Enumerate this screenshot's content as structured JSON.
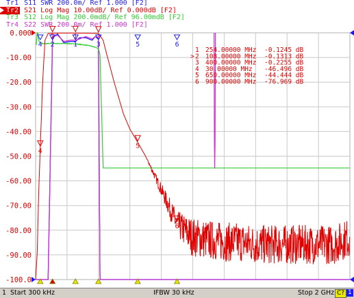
{
  "traces": [
    {
      "tag": "Tr1",
      "param": "S11",
      "format": "SWR",
      "scale": "200.0m/",
      "ref": "Ref 1.000",
      "channel": "[F2]",
      "color": "#1a1aff",
      "active": false
    },
    {
      "tag": "Tr2",
      "param": "S21",
      "format": "Log Mag",
      "scale": "10.00dB/",
      "ref": "Ref 0.000dB",
      "channel": "[F2]",
      "color": "#e00000",
      "active": true
    },
    {
      "tag": "Tr3",
      "param": "S12",
      "format": "Log Mag",
      "scale": "200.0mdB/",
      "ref": "Ref 96.00mdB",
      "channel": "[F2]",
      "color": "#33cc33",
      "active": false
    },
    {
      "tag": "Tr4",
      "param": "S22",
      "format": "SWR",
      "scale": "200.0m/",
      "ref": "Ref 1.000",
      "channel": "[F2]",
      "color": "#cc33cc",
      "active": false
    }
  ],
  "y_axis": {
    "labels": [
      "0.000",
      "-10.00",
      "-20.00",
      "-30.00",
      "-40.00",
      "-50.00",
      "-60.00",
      "-70.00",
      "-80.00",
      "-90.00",
      "-100.0"
    ],
    "ylim": [
      -100,
      0
    ],
    "color": "#e00000"
  },
  "x_axis": {
    "start_mhz": 0.3,
    "stop_mhz": 2000,
    "divisions": 10
  },
  "marker_table": {
    "active_prefix": ">",
    "rows": [
      {
        "num": "1",
        "freq": "254.00000 MHz",
        "value": "-0.1245 dB",
        "active": false
      },
      {
        "num": "2",
        "freq": "108.00000 MHz",
        "value": "-0.1313 dB",
        "active": true
      },
      {
        "num": "3",
        "freq": "400.00000 MHz",
        "value": "-0.2255 dB",
        "active": false
      },
      {
        "num": "4",
        "freq": "30.00000 MHz",
        "value": "-46.496 dB",
        "active": false
      },
      {
        "num": "5",
        "freq": "650.00000 MHz",
        "value": "-44.444 dB",
        "active": false
      },
      {
        "num": "6",
        "freq": "900.00000 MHz",
        "value": "-76.969 dB",
        "active": false
      }
    ]
  },
  "chart_data": {
    "type": "line",
    "title": "",
    "xlabel": "",
    "ylabel": "",
    "xlim_mhz": [
      0.3,
      2000
    ],
    "ylim": [
      -100,
      0
    ],
    "grid": true,
    "series": [
      {
        "name": "S21",
        "color": "#e00000",
        "x_mhz": [
          0.3,
          10,
          20,
          30,
          45,
          60,
          80,
          108,
          160,
          254,
          320,
          400,
          430,
          450,
          500,
          560,
          600,
          650,
          700,
          760,
          820,
          900,
          1000,
          1100,
          1200,
          1300,
          1400,
          1500,
          1600,
          1700,
          1800,
          1900,
          2000
        ],
        "y_db": [
          -100,
          -90,
          -65,
          -46.5,
          -20,
          -3,
          -0.3,
          -0.13,
          -0.12,
          -0.12,
          -0.15,
          -0.23,
          -3,
          -8,
          -20,
          -33,
          -39,
          -44.4,
          -50,
          -58,
          -66,
          -77,
          -82,
          -83,
          -84,
          -84,
          -85,
          -85,
          -85,
          -85,
          -85,
          -85,
          -82
        ]
      },
      {
        "name": "S12",
        "color": "#33cc33",
        "x_mhz": [
          0.3,
          5,
          10,
          15,
          18,
          22,
          30,
          40,
          60,
          80,
          108,
          140,
          180,
          220,
          254,
          290,
          320,
          350,
          370,
          390,
          400,
          410,
          430,
          2000
        ],
        "y_mdb": [
          0,
          0,
          96,
          96,
          44,
          28,
          12,
          10,
          8,
          9,
          10,
          9,
          9,
          8,
          6,
          1,
          -4,
          -10,
          -18,
          -26,
          -34,
          -80,
          -1000,
          -1000
        ]
      },
      {
        "name": "S11",
        "color": "#1a1aff",
        "x_mhz": [
          0.3,
          20,
          40,
          60,
          80,
          108,
          140,
          180,
          220,
          254,
          280,
          320,
          360,
          380,
          400,
          410,
          420,
          430,
          2000
        ],
        "swr": [
          3.0,
          3.0,
          3.0,
          3.0,
          3.0,
          1.04,
          1.01,
          1.08,
          1.07,
          1.07,
          1.04,
          1.04,
          1.06,
          1.03,
          1.05,
          3.0,
          3.0,
          3.0,
          3.0
        ]
      },
      {
        "name": "S22",
        "color": "#cc33cc",
        "x_mhz": [
          0.3,
          20,
          40,
          60,
          80,
          108,
          140,
          180,
          220,
          254,
          280,
          320,
          360,
          380,
          400,
          410,
          420,
          430,
          2000
        ],
        "swr": [
          3.0,
          3.0,
          3.0,
          3.0,
          3.0,
          1.03,
          1.02,
          1.07,
          1.06,
          1.06,
          1.05,
          1.03,
          1.05,
          1.03,
          1.04,
          3.0,
          3.0,
          3.0,
          3.0
        ]
      }
    ],
    "spur": {
      "x_mhz": 1140,
      "y_db": -55
    }
  },
  "markers": [
    {
      "label": "1",
      "x_mhz": 254
    },
    {
      "label": "2",
      "x_mhz": 108
    },
    {
      "label": "3",
      "x_mhz": 400
    },
    {
      "label": "4",
      "x_mhz": 30
    },
    {
      "label": "5",
      "x_mhz": 650
    },
    {
      "label": "6",
      "x_mhz": 900
    }
  ],
  "status": {
    "channel": "1",
    "start": "Start 300 kHz",
    "ifbw": "IFBW 30 kHz",
    "stop": "Stop 2 GHz",
    "badge": "C?",
    "badge2": "1"
  }
}
